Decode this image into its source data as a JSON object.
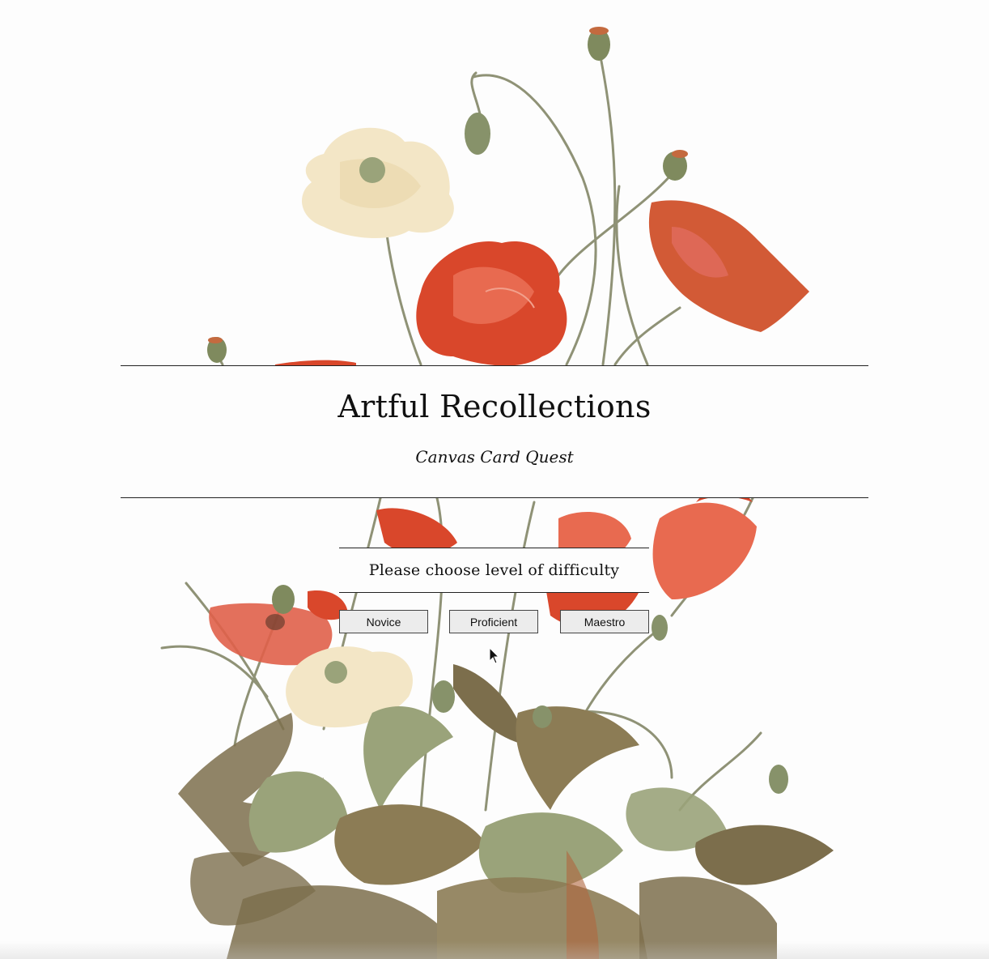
{
  "header": {
    "title": "Artful Recollections",
    "subtitle": "Canvas Card Quest"
  },
  "difficulty": {
    "prompt": "Please choose level of difficulty",
    "options": [
      "Novice",
      "Proficient",
      "Maestro"
    ]
  },
  "colors": {
    "poppy_red": "#d9472b",
    "poppy_coral": "#e86a50",
    "poppy_cream": "#f3e6c6",
    "foliage_olive": "#7c6e4c",
    "foliage_sage": "#9aa37a",
    "stem": "#8f9276"
  }
}
